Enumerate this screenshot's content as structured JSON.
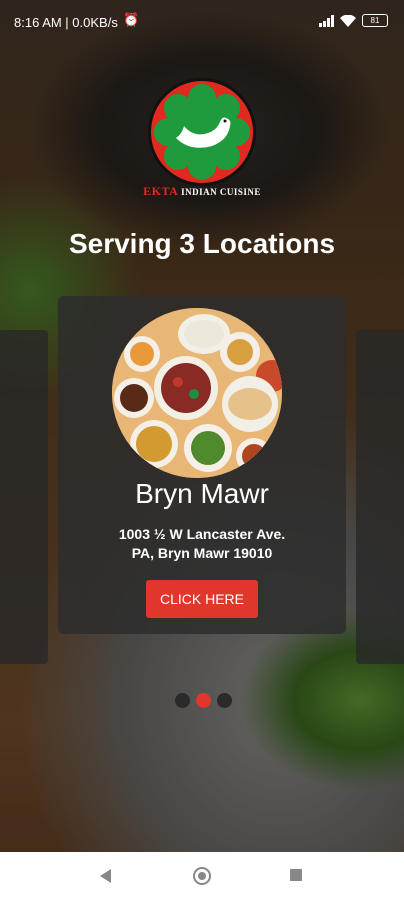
{
  "status": {
    "time_and_speed": "8:16 AM | 0.0KB/s",
    "battery": "81"
  },
  "brand": {
    "name_red": "EKTA",
    "name_rest": "INDIAN CUISINE"
  },
  "headline": "Serving 3 Locations",
  "location": {
    "name": "Bryn Mawr",
    "address_line1": "1003 ½ W Lancaster Ave.",
    "address_line2": "PA, Bryn Mawr 19010",
    "button_label": "CLICK HERE"
  },
  "pager": {
    "total": 3,
    "active_index": 1
  },
  "colors": {
    "accent": "#e0362c",
    "logo_green": "#1f9a3c"
  }
}
